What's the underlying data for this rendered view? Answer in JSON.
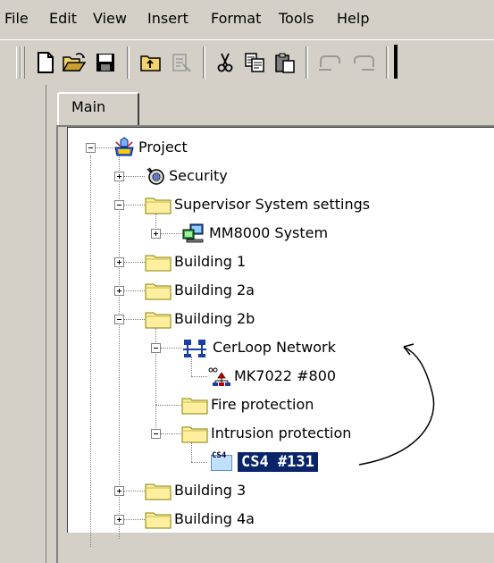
{
  "menubar": {
    "items": [
      "File",
      "Edit",
      "View",
      "Insert",
      "Format",
      "Tools",
      "Help"
    ]
  },
  "toolbar": {
    "buttons": [
      "new-icon",
      "open-icon",
      "save-icon",
      "up-level-icon",
      "properties-icon",
      "cut-icon",
      "copy-icon",
      "paste-icon",
      "undo-icon",
      "redo-icon"
    ]
  },
  "tabs": {
    "main": "Main"
  },
  "tree": {
    "project": "Project",
    "security": "Security",
    "supervisor": "Supervisor System settings",
    "mm8000": "MM8000 System",
    "building1": "Building 1",
    "building2a": "Building 2a",
    "building2b": "Building 2b",
    "cerloop": "CerLoop Network",
    "mk7022": "MK7022 #800",
    "fire": "Fire protection",
    "intrusion": "Intrusion protection",
    "cs4": "CS4 #131",
    "cs4_icon_text": "CS4",
    "building3": "Building 3",
    "building4a": "Building 4a"
  },
  "colors": {
    "selection": "#0a246a",
    "folder": "#ffef9e",
    "background": "#d4d0c8"
  }
}
